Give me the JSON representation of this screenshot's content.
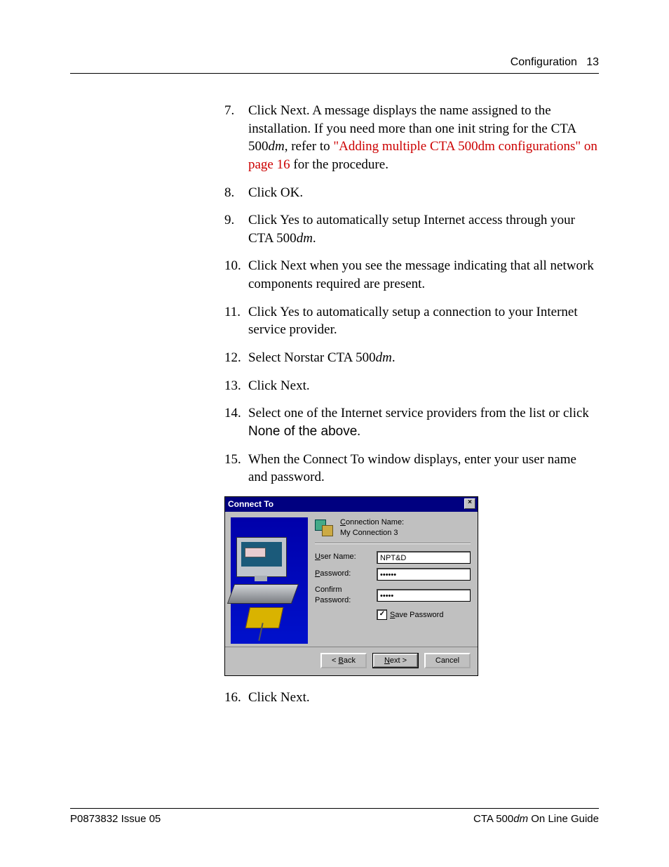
{
  "header": {
    "section": "Configuration",
    "page_no": "13"
  },
  "steps": {
    "s7": {
      "num": "7.",
      "t1": "Click Next. A message displays the name assigned to the installation. If you need more than one init string for the CTA 500",
      "dm": "dm",
      "t2": ", refer to ",
      "link": "\"Adding multiple CTA 500dm configurations\" on page 16",
      "t3": " for the procedure."
    },
    "s8": {
      "num": "8.",
      "t": "Click OK."
    },
    "s9": {
      "num": "9.",
      "t1": "Click Yes to automatically setup Internet access through your CTA 500",
      "dm": "dm",
      "t2": "."
    },
    "s10": {
      "num": "10.",
      "t": "Click Next when you see the message indicating that all network components required are present."
    },
    "s11": {
      "num": "11.",
      "t": "Click Yes to automatically setup a connection to your Internet service provider."
    },
    "s12": {
      "num": "12.",
      "t1": "Select Norstar CTA 500",
      "dm": "dm",
      "t2": "."
    },
    "s13": {
      "num": "13.",
      "t": "Click Next."
    },
    "s14": {
      "num": "14.",
      "t1": "Select one of the Internet service providers from the list or click ",
      "opt": "None of the above",
      "t2": "."
    },
    "s15": {
      "num": "15.",
      "t": "When the Connect To window displays, enter your user name and password."
    },
    "s16": {
      "num": "16.",
      "t": "Click Next."
    }
  },
  "dialog": {
    "title": "Connect To",
    "close": "×",
    "conn_label_c": "C",
    "conn_label_rest": "onnection Name:",
    "conn_value": "My Connection 3",
    "user_label_u": "U",
    "user_label_rest": "ser Name:",
    "user_value": "NPT&D",
    "pass_label_p": "P",
    "pass_label_rest": "assword:",
    "pass_value": "••••••",
    "confirm_label": "Confirm Password:",
    "confirm_value": "•••••",
    "save_check": "✓",
    "save_s": "S",
    "save_rest": "ave Password",
    "back_lt": "< ",
    "back_b": "B",
    "back_rest": "ack",
    "next_n": "N",
    "next_rest": "ext >",
    "cancel": "Cancel"
  },
  "footer": {
    "left": "P0873832  Issue 05",
    "right_pre": "CTA 500",
    "right_dm": "dm",
    "right_post": " On Line Guide"
  }
}
